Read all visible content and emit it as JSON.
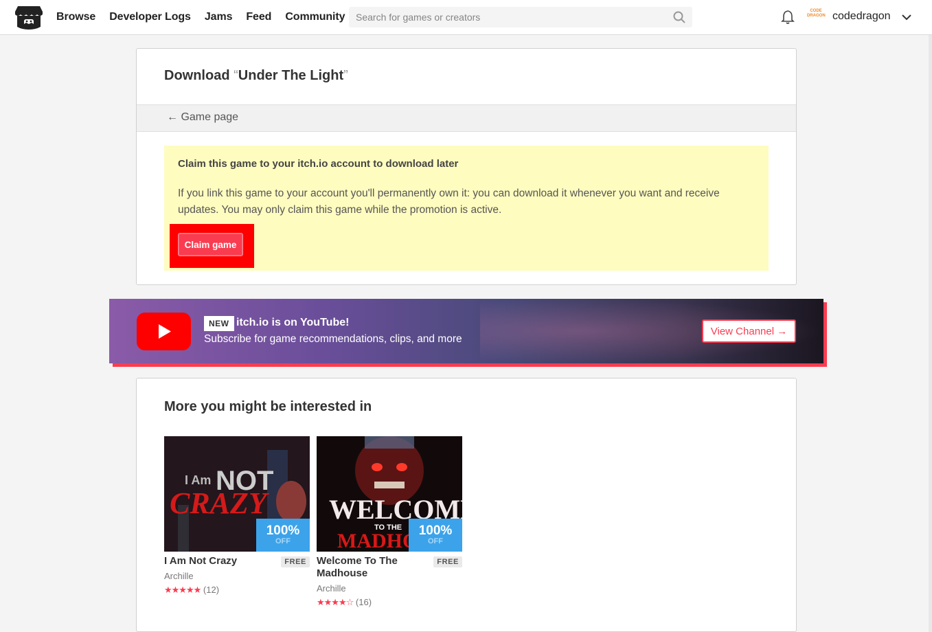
{
  "header": {
    "nav": [
      "Browse",
      "Developer Logs",
      "Jams",
      "Feed",
      "Community"
    ],
    "search_placeholder": "Search for games or creators",
    "avatar_text": "CODE DRAGON",
    "username": "codedragon"
  },
  "download": {
    "title_prefix": "Download ",
    "quote_open": "“",
    "game_name": "Under The Light",
    "quote_close": "”",
    "back_link": "← Game page",
    "claim_heading": "Claim this game to your itch.io account to download later",
    "claim_text": "If you link this game to your account you'll permanently own it: you can download it whenever you want and receive updates. You may only claim this game while the promotion is active.",
    "claim_button": "Claim game"
  },
  "youtube_banner": {
    "badge": "NEW",
    "title": "itch.io is on YouTube!",
    "subtitle": "Subscribe for game recommendations, clips, and more",
    "button": "View Channel →"
  },
  "recommendations": {
    "title": "More you might be interested in",
    "games": [
      {
        "title": "I Am Not Crazy",
        "price": "FREE",
        "author": "Archille",
        "stars": "★★★★★",
        "count": "(12)",
        "sale_pct": "100%",
        "sale_off": "OFF"
      },
      {
        "title": "Welcome To The Madhouse",
        "price": "FREE",
        "author": "Archille",
        "stars": "★★★★☆",
        "count": "(16)",
        "sale_pct": "100%",
        "sale_off": "OFF"
      }
    ]
  },
  "colors": {
    "accent": "#fa3c50",
    "sale": "#3ca3ea",
    "claim_bg": "#fefcbf",
    "highlight": "#ff0000"
  },
  "icons": [
    "itchio-logo-icon",
    "search-icon",
    "bell-icon",
    "chevron-down-icon",
    "youtube-play-icon"
  ]
}
